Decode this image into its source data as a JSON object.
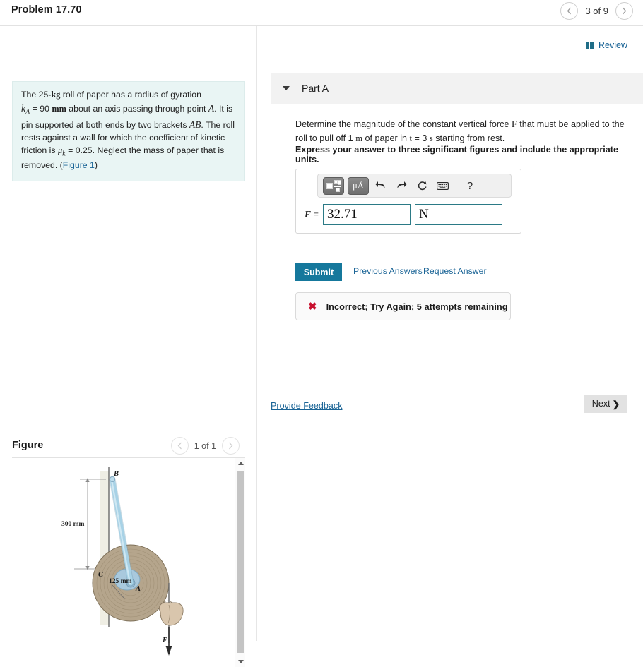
{
  "header": {
    "problem_title": "Problem 17.70",
    "pager_label": "3 of 9",
    "prev_icon": "chevron-left-icon",
    "next_icon": "chevron-right-icon"
  },
  "left": {
    "problem_statement": {
      "line1_a": "The 25-",
      "line1_kg": "kg",
      "line1_b": " roll of paper has a radius of gyration",
      "ka": "k",
      "ka_sub": "A",
      "eq1": " = 90 ",
      "mm": "mm",
      "after_mm": " about an axis passing through point ",
      "pointA": "A",
      "sent2": ". It is pin supported at both ends by two brackets ",
      "ab": "AB",
      "sent3": ". The roll rests against a wall for which the coefficient of kinetic friction is ",
      "mu": "μ",
      "mu_sub": "k",
      "eq2": " = 0.25. Neglect the mass of paper that is removed. (",
      "figure_link": "Figure 1",
      "close_paren": ")"
    },
    "figure": {
      "title": "Figure",
      "pager_label": "1 of 1",
      "prev_icon": "chevron-left-icon",
      "next_icon": "chevron-right-icon",
      "labels": {
        "b": "B",
        "a": "A",
        "c": "C",
        "dim_300": "300 mm",
        "dim_125": "125 mm",
        "force": "F"
      },
      "colors": {
        "roll": "#b5a58c",
        "bracket": "#9cc9de",
        "wall": "#efeee4",
        "hand": "#d9c6ad"
      }
    },
    "scrollbar": {
      "up_icon": "triangle-up-icon",
      "down_icon": "triangle-down-icon"
    }
  },
  "right": {
    "review": {
      "label": "Review",
      "icon": "book-icon"
    },
    "part": {
      "title": "Part A",
      "caret_icon": "caret-down-icon",
      "question": "Determine the magnitude of the constant vertical force F that must be applied to the roll to pull off 1 m of paper in t = 3 s starting from rest.",
      "question_parts": {
        "p1": "Determine the magnitude of the constant vertical force ",
        "F": "F",
        "p2": " that must be applied to the roll to pull off 1 ",
        "m": "m",
        "p3": " of paper in ",
        "t": "t",
        "p4": " = 3 ",
        "s": "s",
        "p5": " starting from rest."
      },
      "express": "Express your answer to three significant figures and include the appropriate units."
    },
    "answer": {
      "label_f": "F",
      "label_eq": "=",
      "value": "32.71",
      "value_placeholder": "",
      "unit": "N",
      "unit_placeholder": "",
      "toolbar": {
        "template_icon": "math-template-icon",
        "units_icon": "units-micro-angstrom-icon",
        "units_label": "μÅ",
        "undo_icon": "undo-arrow-icon",
        "redo_icon": "redo-arrow-icon",
        "reset_icon": "reset-circular-arrow-icon",
        "keyboard_icon": "keyboard-icon",
        "help_icon": "question-mark-icon",
        "help_label": "?"
      }
    },
    "actions": {
      "submit": "Submit",
      "previous_answers": "Previous Answers",
      "request_answer": "Request Answer"
    },
    "feedback": {
      "icon": "x-mark-icon",
      "icon_glyph": "✖",
      "message": "Incorrect; Try Again; 5 attempts remaining",
      "color": "#c8102e"
    },
    "footer": {
      "provide_feedback": "Provide Feedback",
      "next": "Next",
      "next_chevron": "❯"
    }
  }
}
